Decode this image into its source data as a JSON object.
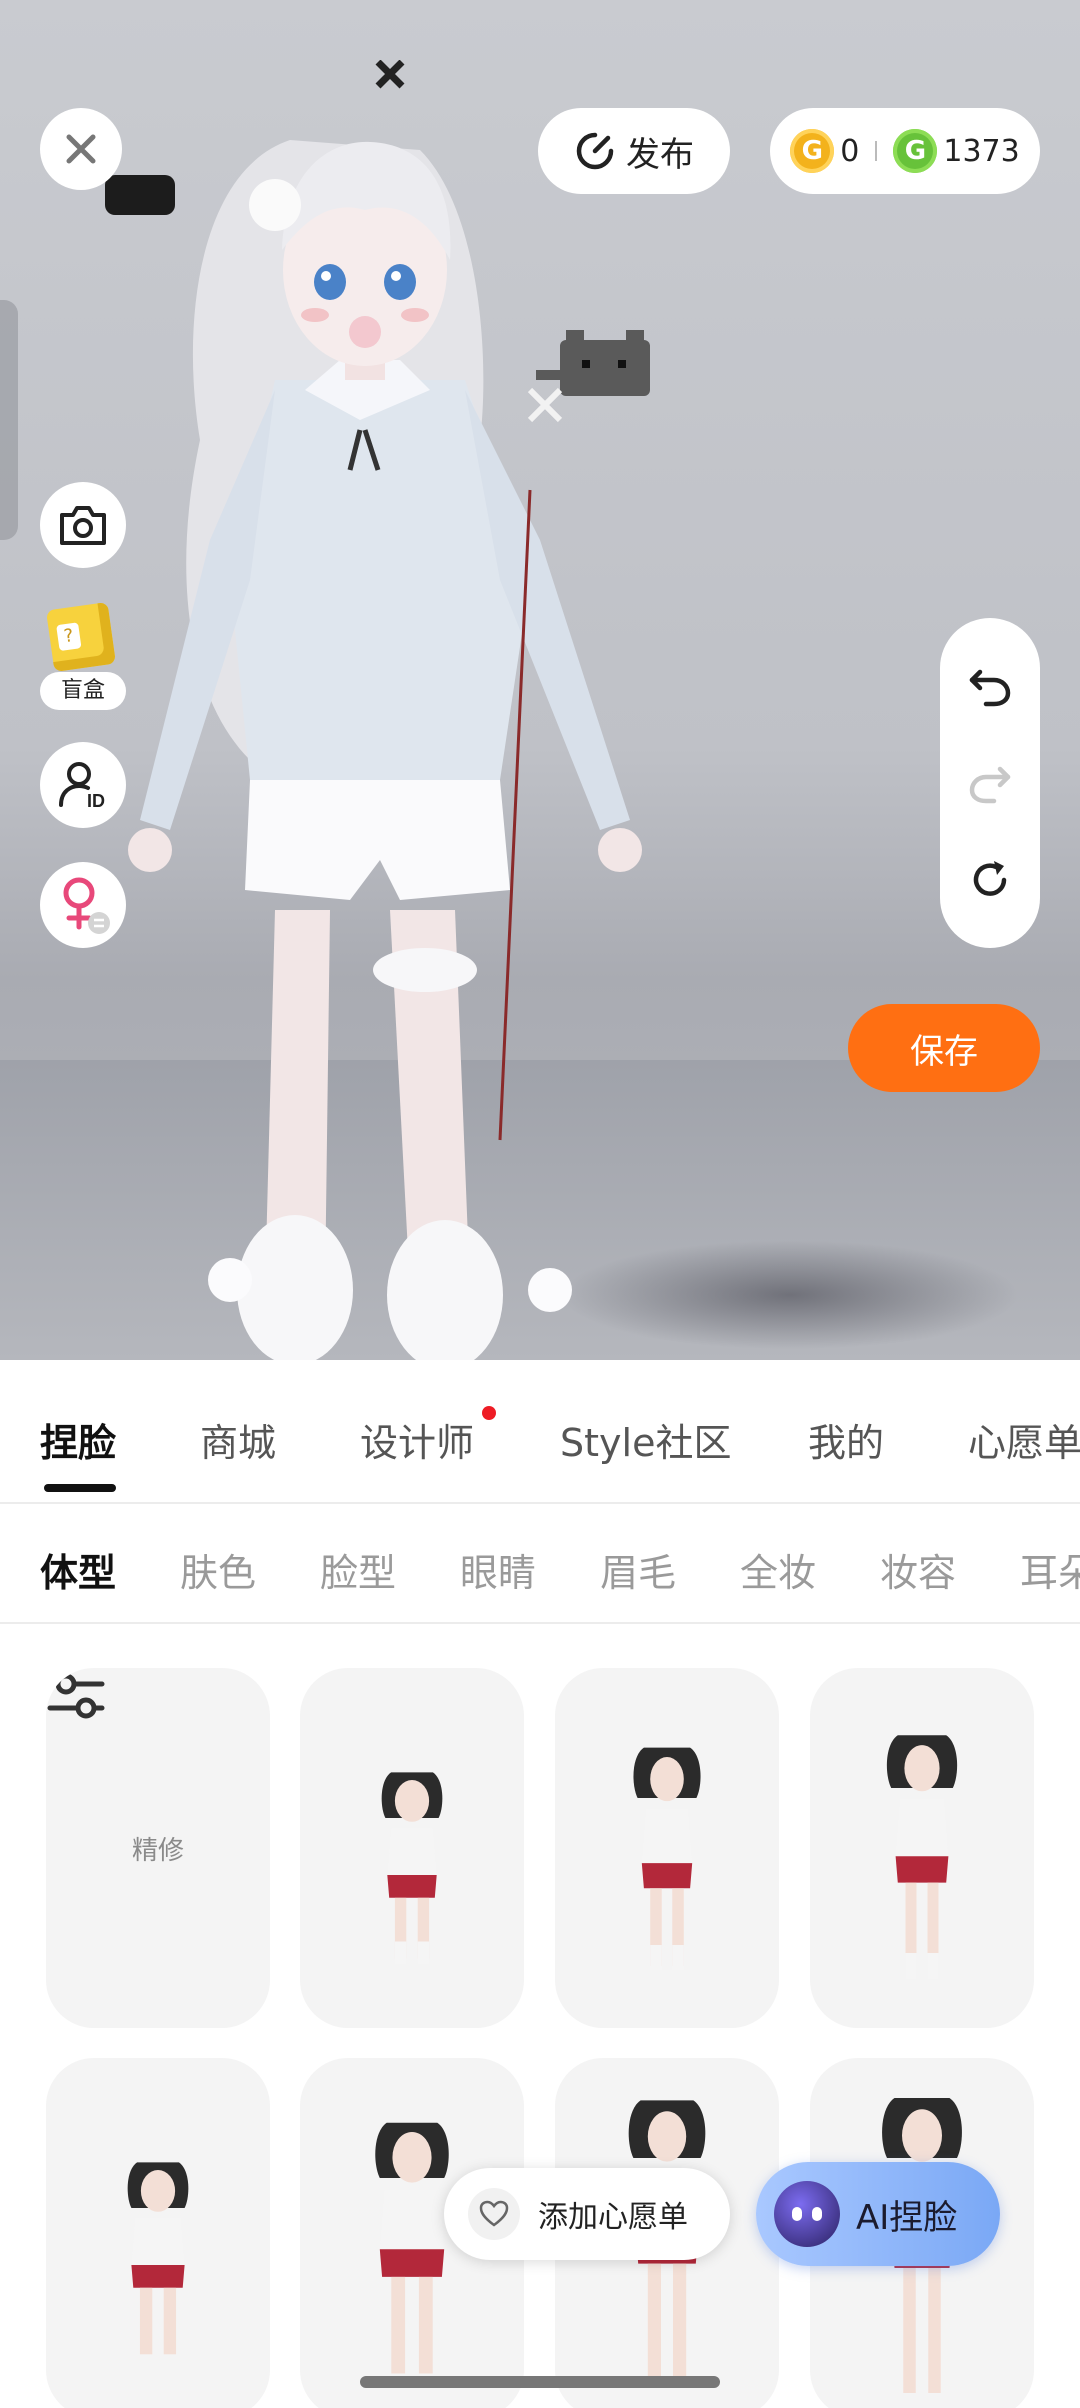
{
  "header": {
    "publish_label": "发布",
    "coins_gold": "0",
    "coins_green": "1373"
  },
  "sidebar": {
    "blind_box_label": "盲盒"
  },
  "actions": {
    "save_label": "保存"
  },
  "main_tabs": [
    "捏脸",
    "商城",
    "设计师",
    "Style社区",
    "我的",
    "心愿单"
  ],
  "active_main_tab": "捏脸",
  "sub_tabs": [
    "体型",
    "肤色",
    "脸型",
    "眼睛",
    "眉毛",
    "全妆",
    "妆容",
    "耳朵"
  ],
  "active_sub_tab": "体型",
  "grid": {
    "fine_tune_label": "精修"
  },
  "floating": {
    "wishlist_label": "添加心愿单",
    "ai_face_label": "AI捏脸"
  },
  "colors": {
    "accent_orange": "#ff6f12",
    "notification_red": "#ee1c25",
    "gold_coin": "#f3b21c",
    "green_coin": "#67c23a"
  }
}
